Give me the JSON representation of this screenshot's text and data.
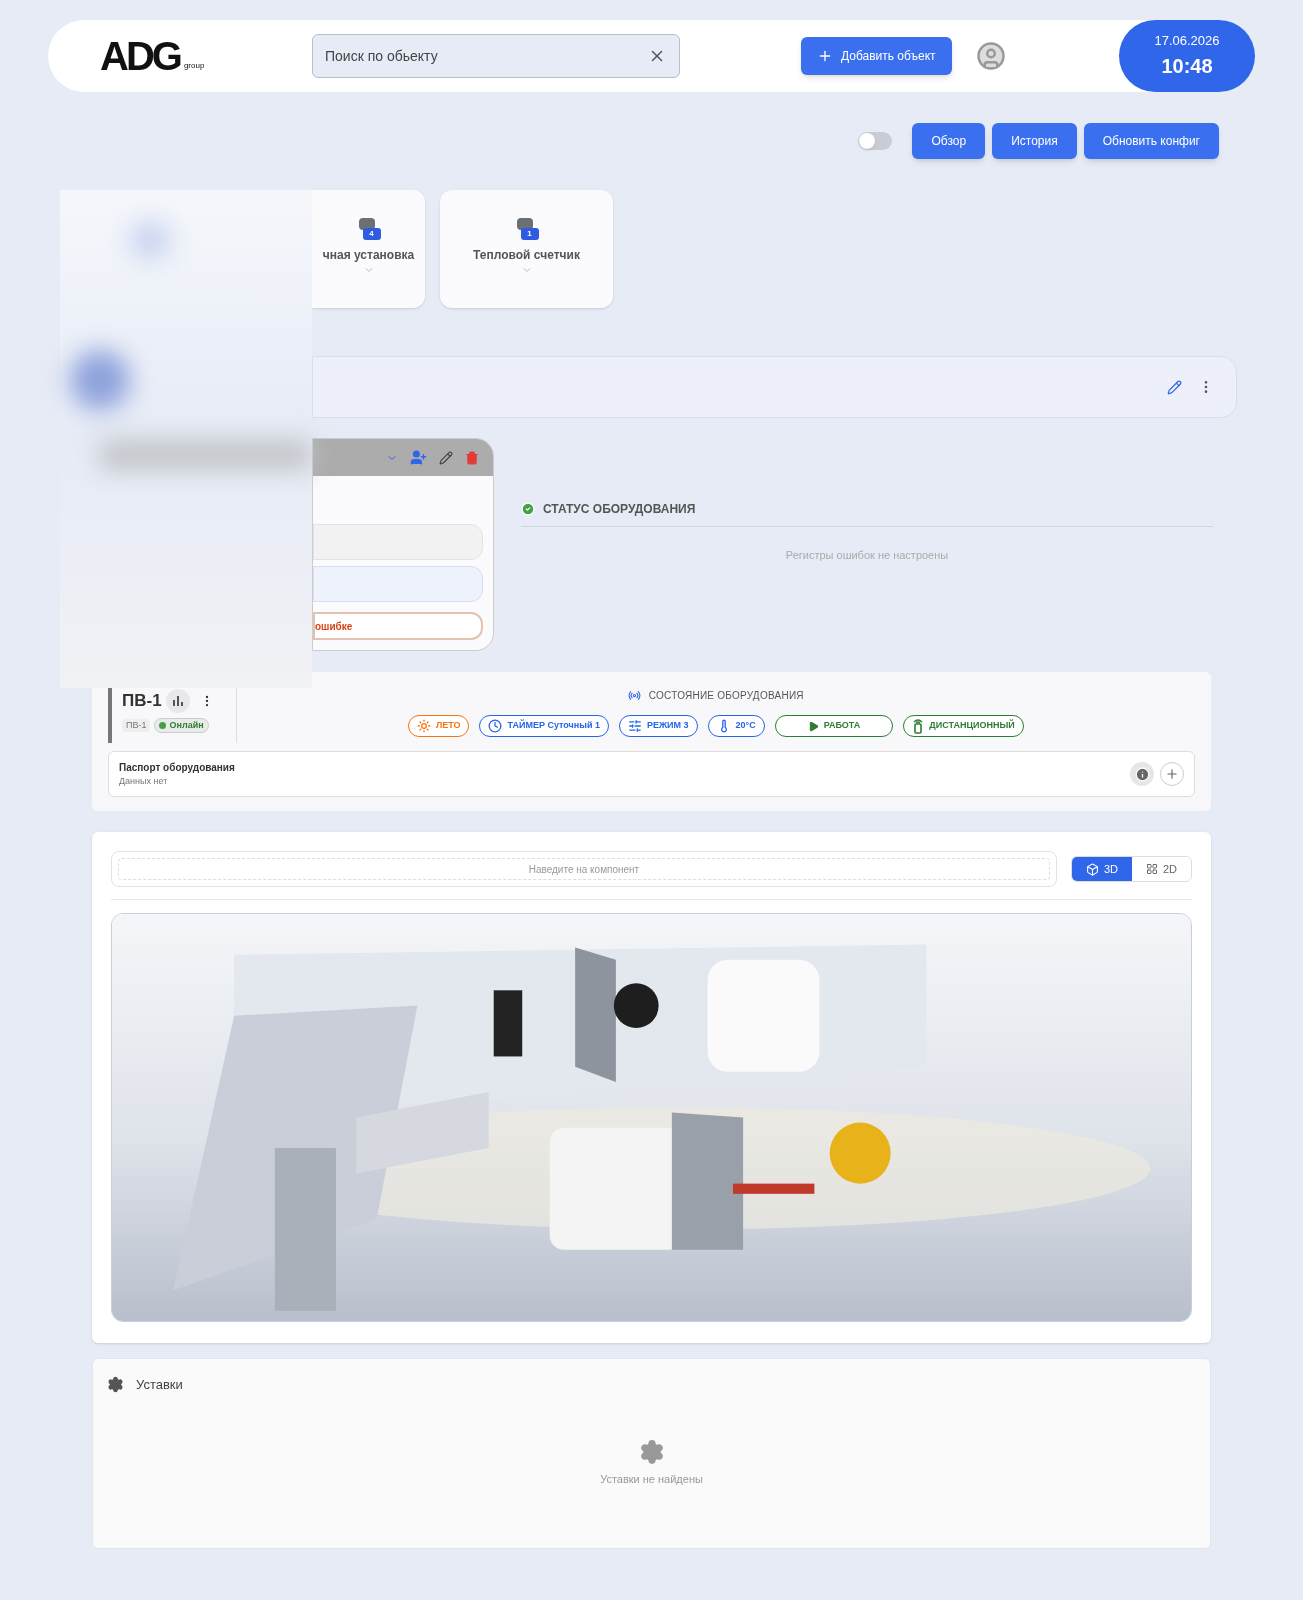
{
  "header": {
    "logo": "ADG",
    "logo_sub": "group",
    "search": {
      "placeholder": "Поиск по обьекту"
    },
    "add_button": "Добавить объект",
    "date": "17.06.2026",
    "time": "10:48"
  },
  "toolbar": {
    "toggle": {
      "on": false
    },
    "buttons": [
      "Обзор",
      "История",
      "Обновить конфиг"
    ]
  },
  "device_cards": [
    {
      "label": "чная установка",
      "count": "4"
    },
    {
      "label": "Тепловой счетчик",
      "count": "1"
    }
  ],
  "object_card": {
    "error_button": "ошибке"
  },
  "equipment_status": {
    "title": "СТАТУС ОБОРУДОВАНИЯ",
    "empty": "Регистры ошибок не настроены"
  },
  "unit": {
    "name": "ПВ-1",
    "tag": "ПВ-1",
    "status": "Онлайн",
    "online": true,
    "state_title": "СОСТОЯНИЕ ОБОРУДОВАНИЯ",
    "chips": [
      {
        "kind": "season",
        "label": "ЛЕТО",
        "color": "#f97316"
      },
      {
        "kind": "timer",
        "label": "ТАЙМЕР Суточный 1",
        "color": "#2563eb"
      },
      {
        "kind": "mode",
        "label": "РЕЖИМ 3",
        "color": "#2563eb"
      },
      {
        "kind": "temp",
        "label": "20°C",
        "color": "#2563eb"
      },
      {
        "kind": "run",
        "label": "РАБОТА",
        "color": "#2e7d32"
      },
      {
        "kind": "remote",
        "label": "ДИСТАНЦИОННЫЙ",
        "color": "#2e7d32"
      }
    ],
    "passport": {
      "title": "Паспорт оборудования",
      "subtitle": "Данных нет"
    }
  },
  "viewer": {
    "hint": "Наведите на компонент",
    "views": [
      {
        "kind": "model",
        "label": "3D",
        "selected": true
      },
      {
        "kind": "plan",
        "label": "2D",
        "selected": false
      }
    ]
  },
  "settings": {
    "title": "Уставки",
    "empty": "Уставки не найдены"
  }
}
